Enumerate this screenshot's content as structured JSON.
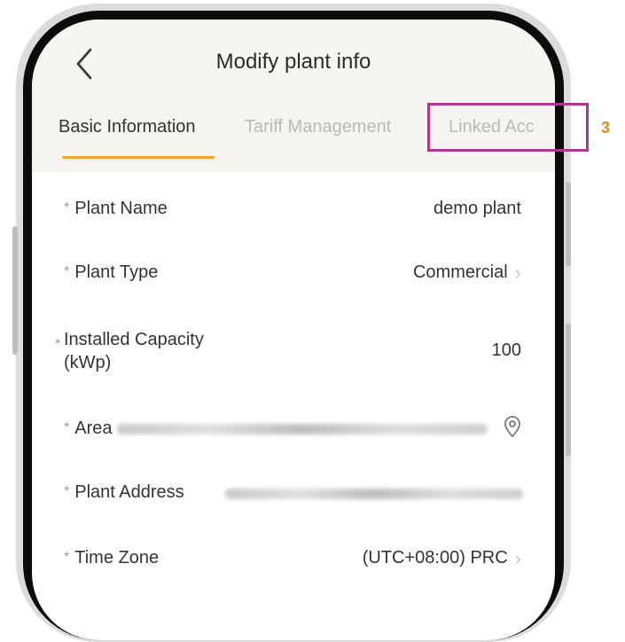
{
  "header": {
    "title": "Modify plant info"
  },
  "tabs": [
    {
      "label": "Basic Information",
      "active": true
    },
    {
      "label": "Tariff Management",
      "active": false
    },
    {
      "label": "Linked Acc",
      "active": false
    }
  ],
  "form": {
    "required_mark": "*",
    "plant_name": {
      "label": "Plant Name",
      "value": "demo plant"
    },
    "plant_type": {
      "label": "Plant Type",
      "value": "Commercial"
    },
    "installed_capacity": {
      "label_line1": "Installed Capacity",
      "label_line2": "(kWp)",
      "value": "100"
    },
    "area": {
      "label": "Area"
    },
    "plant_address": {
      "label": "Plant Address"
    },
    "time_zone": {
      "label": "Time Zone",
      "value": "(UTC+08:00) PRC"
    }
  },
  "annotation": {
    "step_number": "3"
  },
  "colors": {
    "accent": "#f0a431",
    "highlight": "#b1348f",
    "step_number": "#e08a1e"
  }
}
